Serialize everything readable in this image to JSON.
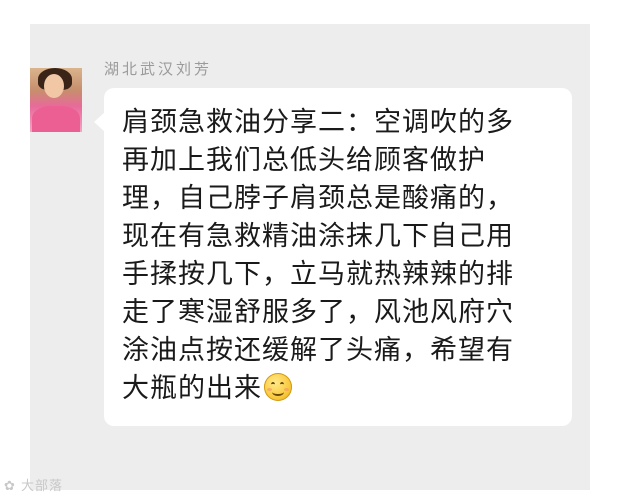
{
  "chat": {
    "sender_name": "湖北武汉刘芳",
    "message_lines": [
      "肩颈急救油分享二：空调吹的多",
      "再加上我们总低头给顾客做护",
      "理，自己脖子肩颈总是酸痛的，",
      "现在有急救精油涂抹几下自己用",
      "手揉按几下，立马就热辣辣的排",
      "走了寒湿舒服多了，风池风府穴",
      "涂油点按还缓解了头痛，希望有",
      "大瓶的出来"
    ],
    "emoji": "smile-emoji"
  },
  "watermark": {
    "text": "大部落"
  },
  "colors": {
    "chat_background": "#ededed",
    "bubble_background": "#ffffff",
    "message_text": "#1a1a1a",
    "sender_name_text": "#9a9a9a"
  }
}
